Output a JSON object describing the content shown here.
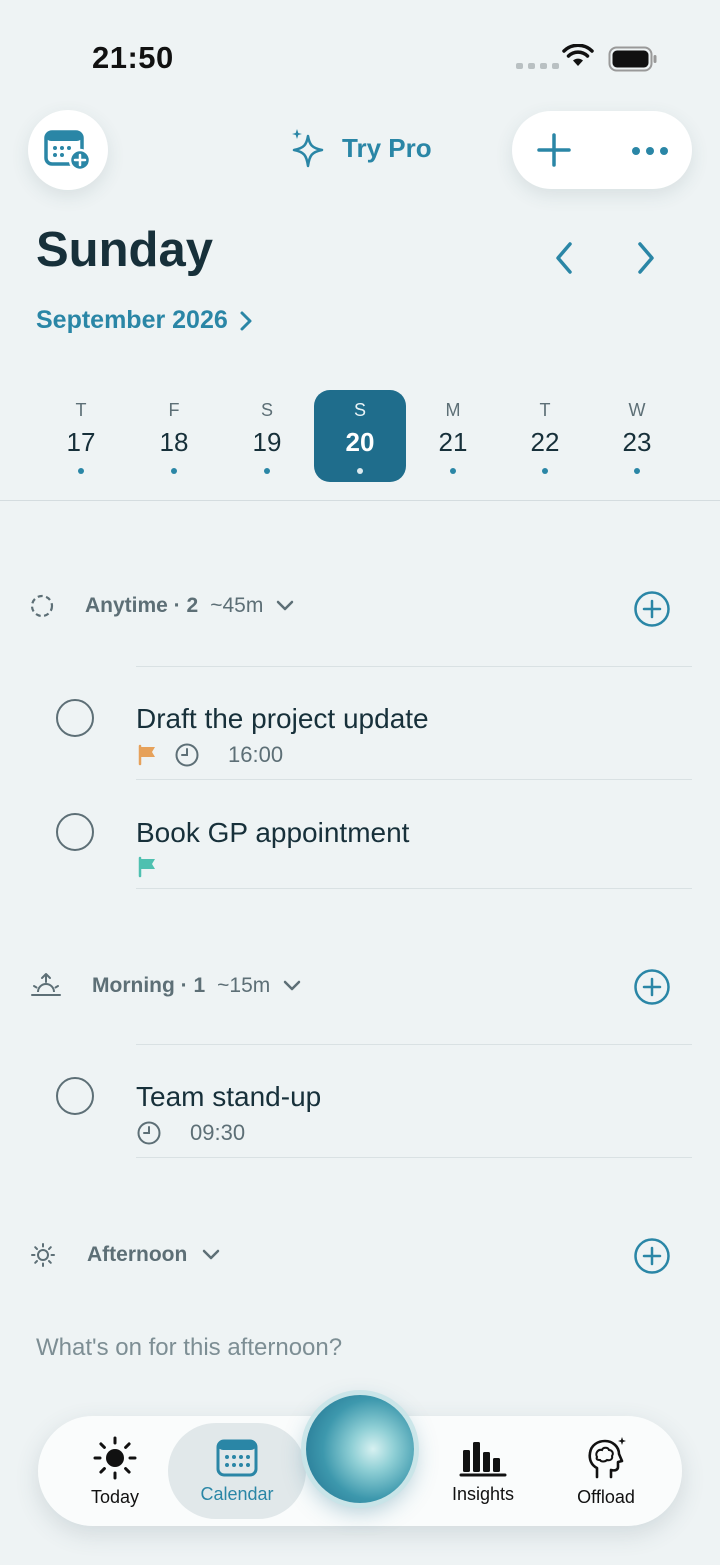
{
  "status_bar": {
    "time": "21:50"
  },
  "header": {
    "try_pro": "Try Pro",
    "day_title": "Sunday",
    "month_label": "September 2026"
  },
  "week": [
    {
      "dow": "T",
      "num": "17",
      "selected": false
    },
    {
      "dow": "F",
      "num": "18",
      "selected": false
    },
    {
      "dow": "S",
      "num": "19",
      "selected": false
    },
    {
      "dow": "S",
      "num": "20",
      "selected": true
    },
    {
      "dow": "M",
      "num": "21",
      "selected": false
    },
    {
      "dow": "T",
      "num": "22",
      "selected": false
    },
    {
      "dow": "W",
      "num": "23",
      "selected": false
    }
  ],
  "sections": {
    "anytime": {
      "label": "Anytime · 2",
      "duration": "~45m"
    },
    "morning": {
      "label": "Morning · 1",
      "duration": "~15m"
    },
    "afternoon": {
      "label": "Afternoon",
      "placeholder": "What's on for this afternoon?"
    }
  },
  "tasks": {
    "t1": {
      "title": "Draft the project update",
      "time": "16:00",
      "flag_color": "#e6a15a"
    },
    "t2": {
      "title": "Book GP appointment",
      "flag_color": "#4fc0b0"
    },
    "t3": {
      "title": "Team stand-up",
      "time": "09:30"
    }
  },
  "tabbar": {
    "today": "Today",
    "calendar": "Calendar",
    "insights": "Insights",
    "offload": "Offload"
  },
  "colors": {
    "accent": "#2a86a6",
    "selected_day": "#1f6d8c",
    "background": "#eef3f4"
  }
}
